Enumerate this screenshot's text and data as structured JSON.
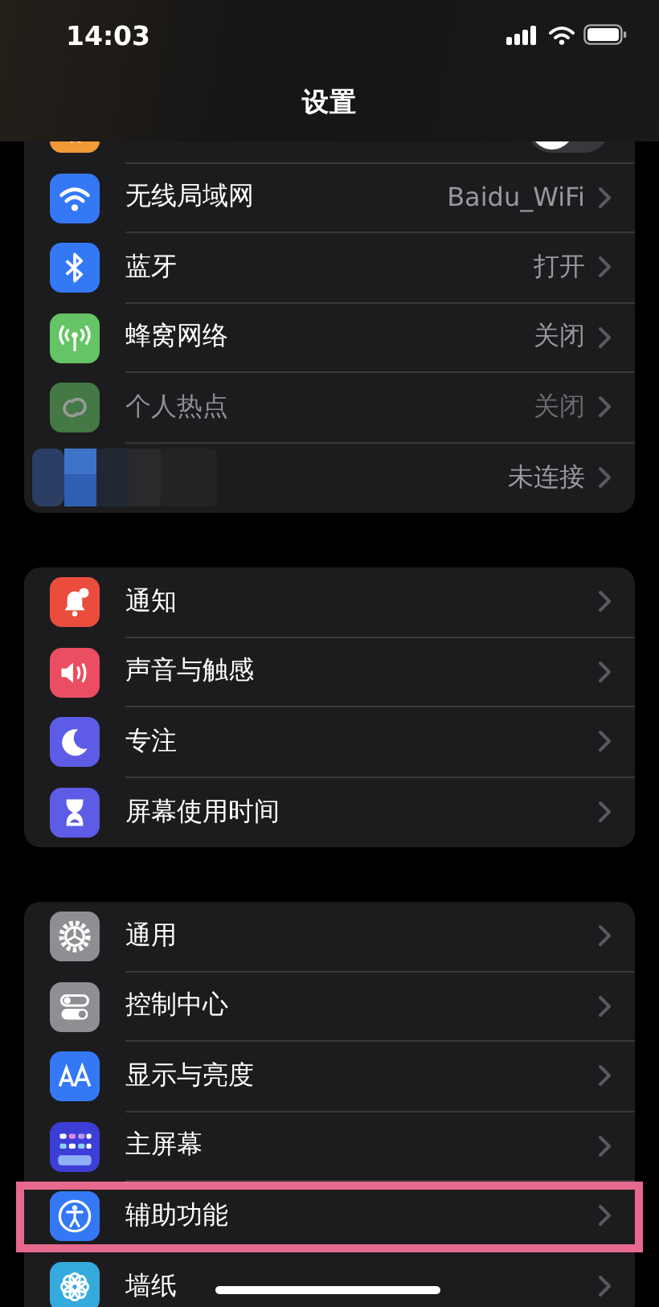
{
  "status_bar": {
    "time": "14:03"
  },
  "header": {
    "title": "设置"
  },
  "groups": [
    {
      "rows": [
        {
          "kind": "airplane",
          "toggle": {
            "on": false
          }
        },
        {
          "kind": "wifi",
          "label": "无线局域网",
          "value": "Baidu_WiFi",
          "disabled": false,
          "highlighted": false
        },
        {
          "kind": "bluetooth",
          "label": "蓝牙",
          "value": "打开",
          "disabled": false,
          "highlighted": false
        },
        {
          "kind": "cellular",
          "label": "蜂窝网络",
          "value": "关闭",
          "disabled": false,
          "highlighted": false
        },
        {
          "kind": "hotspot",
          "label": "个人热点",
          "value": "关闭",
          "disabled": true,
          "highlighted": false
        },
        {
          "kind": "blurred",
          "value": "未连接",
          "disabled": false,
          "highlighted": false
        }
      ]
    },
    {
      "rows": [
        {
          "kind": "notifications",
          "label": "通知",
          "disabled": false,
          "highlighted": false
        },
        {
          "kind": "sounds",
          "label": "声音与触感",
          "disabled": false,
          "highlighted": false
        },
        {
          "kind": "focus",
          "label": "专注",
          "disabled": false,
          "highlighted": false
        },
        {
          "kind": "screentime",
          "label": "屏幕使用时间",
          "disabled": false,
          "highlighted": false
        }
      ]
    },
    {
      "rows": [
        {
          "kind": "general",
          "label": "通用",
          "disabled": false,
          "highlighted": false
        },
        {
          "kind": "controlcenter",
          "label": "控制中心",
          "disabled": false,
          "highlighted": false
        },
        {
          "kind": "display",
          "label": "显示与亮度",
          "disabled": false,
          "highlighted": false
        },
        {
          "kind": "homescreen",
          "label": "主屏幕",
          "disabled": false,
          "highlighted": false
        },
        {
          "kind": "accessibility",
          "label": "辅助功能",
          "disabled": false,
          "highlighted": true
        },
        {
          "kind": "wallpaper",
          "label": "墙纸",
          "disabled": false,
          "highlighted": false
        }
      ]
    }
  ]
}
